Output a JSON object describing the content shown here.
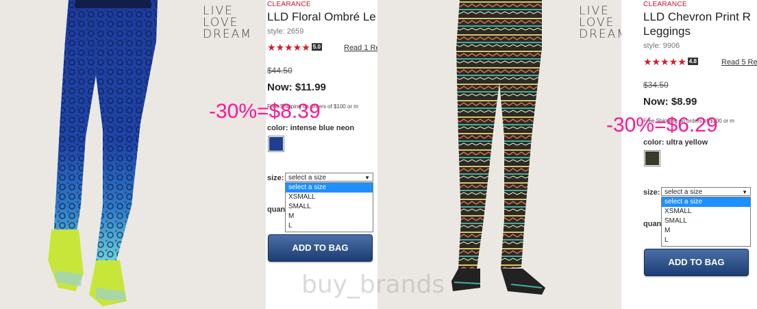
{
  "products": [
    {
      "logo": [
        "LIVE",
        "LOVE",
        "DREAM"
      ],
      "badge": "CLEARANCE",
      "title": "LLD Floral Ombré Le",
      "style": "style: 2659",
      "stars": "★★★★★",
      "rating": "5.0",
      "review_link": "Read 1 Re",
      "old_price": "$44.50",
      "now_price": "Now: $11.99",
      "shipping": "Free Shipping on orders of $100 or m",
      "color_label": "color: intense blue neon",
      "swatch_color": "#1f3f8f",
      "size_label": "size:",
      "size_select": "select a size",
      "size_options": [
        "select a size",
        "XSMALL",
        "SMALL",
        "M",
        "L"
      ],
      "qty_label": "quan",
      "add_button": "ADD TO BAG",
      "promo": "-30%=$8.39"
    },
    {
      "logo": [
        "LIVE",
        "LOVE",
        "DREAM"
      ],
      "badge": "CLEARANCE",
      "title_line1": "LLD Chevron Print R",
      "title_line2": "Leggings",
      "style": "style: 9906",
      "stars": "★★★★★",
      "rating": "4.8",
      "review_link": "Read 5 Re",
      "old_price": "$34.50",
      "now_price": "Now: $8.99",
      "shipping": "Free Shipping on orders of $100 or m",
      "color_label": "color: ultra yellow",
      "swatch_color": "#3a3a2a",
      "size_label": "size:",
      "size_select": "select a size",
      "size_options": [
        "select a size",
        "XSMALL",
        "SMALL",
        "M",
        "L"
      ],
      "qty_label": "quan",
      "add_button": "ADD TO BAG",
      "promo": "-30%=$6.29"
    }
  ],
  "watermark": "buy_brands"
}
